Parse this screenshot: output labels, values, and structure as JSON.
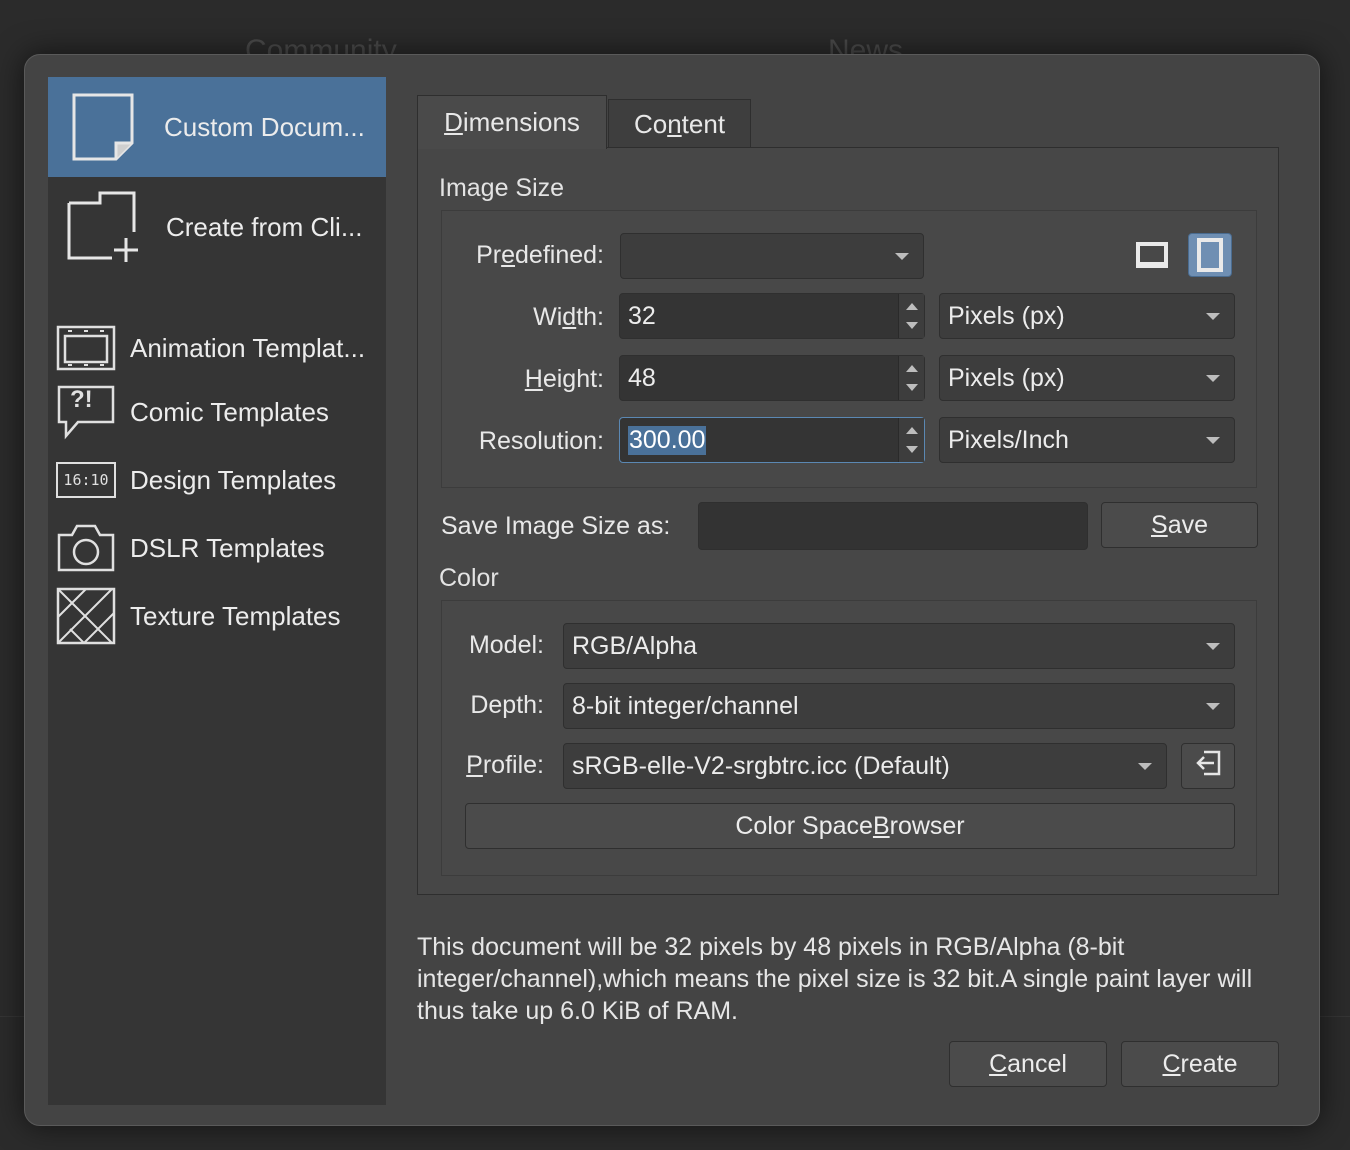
{
  "sidebar": {
    "items": [
      {
        "label": "Custom Docum...",
        "icon": "blank-document-icon",
        "active": true
      },
      {
        "label": "Create from Cli...",
        "icon": "document-plus-icon"
      },
      {
        "label": "Animation Templat...",
        "icon": "film-frame-icon"
      },
      {
        "label": "Comic Templates",
        "icon": "speech-bubble-icon"
      },
      {
        "label": "Design Templates",
        "icon": "ratio-16-10-icon"
      },
      {
        "label": "DSLR Templates",
        "icon": "camera-icon"
      },
      {
        "label": "Texture Templates",
        "icon": "texture-hatch-icon"
      }
    ],
    "ratio_icon_text": "16:10",
    "comic_icon_text": "?!"
  },
  "tabs": {
    "dimensions": {
      "pre": "",
      "u": "D",
      "post": "imensions"
    },
    "content": {
      "pre": "Co",
      "u": "n",
      "post": "tent"
    }
  },
  "image_size": {
    "title": "Image Size",
    "predefined": {
      "pre": "Pr",
      "u": "e",
      "post": "defined:",
      "value": ""
    },
    "width": {
      "pre": "Wi",
      "u": "d",
      "post": "th:",
      "value": "32",
      "unit": "Pixels (px)"
    },
    "height": {
      "pre": "",
      "u": "H",
      "post": "eight:",
      "value": "48",
      "unit": "Pixels (px)"
    },
    "resolution": {
      "label": "Resolution:",
      "value": "300.00",
      "unit": "Pixels/Inch"
    },
    "orientation": {
      "landscape_icon": "landscape-orientation-icon",
      "portrait_icon": "portrait-orientation-icon",
      "selected": "portrait"
    }
  },
  "save_size": {
    "label": "Save Image Size as:",
    "value": "",
    "button": {
      "pre": "",
      "u": "S",
      "post": "ave"
    }
  },
  "color": {
    "title": "Color",
    "model": {
      "label": "Model:",
      "value": "RGB/Alpha"
    },
    "depth": {
      "label": "Depth:",
      "value": "8-bit integer/channel"
    },
    "profile": {
      "pre": "",
      "u": "P",
      "post": "rofile:",
      "value": "sRGB-elle-V2-srgbtrc.icc (Default)",
      "import_icon": "import-profile-icon"
    },
    "browser_button": {
      "pre": "Color Space ",
      "u": "B",
      "post": "rowser"
    }
  },
  "description": "This document will be 32 pixels by 48 pixels in RGB/Alpha (8-bit integer/channel),which means the pixel size is 32 bit.A single paint layer will thus take up 6.0 KiB of RAM.",
  "buttons": {
    "cancel": {
      "pre": "",
      "u": "C",
      "post": "ancel"
    },
    "create": {
      "pre": "",
      "u": "C",
      "post": "reate"
    }
  },
  "colors": {
    "accent": "#4a7199",
    "dialog": "#444444",
    "sidebar": "#353535"
  }
}
